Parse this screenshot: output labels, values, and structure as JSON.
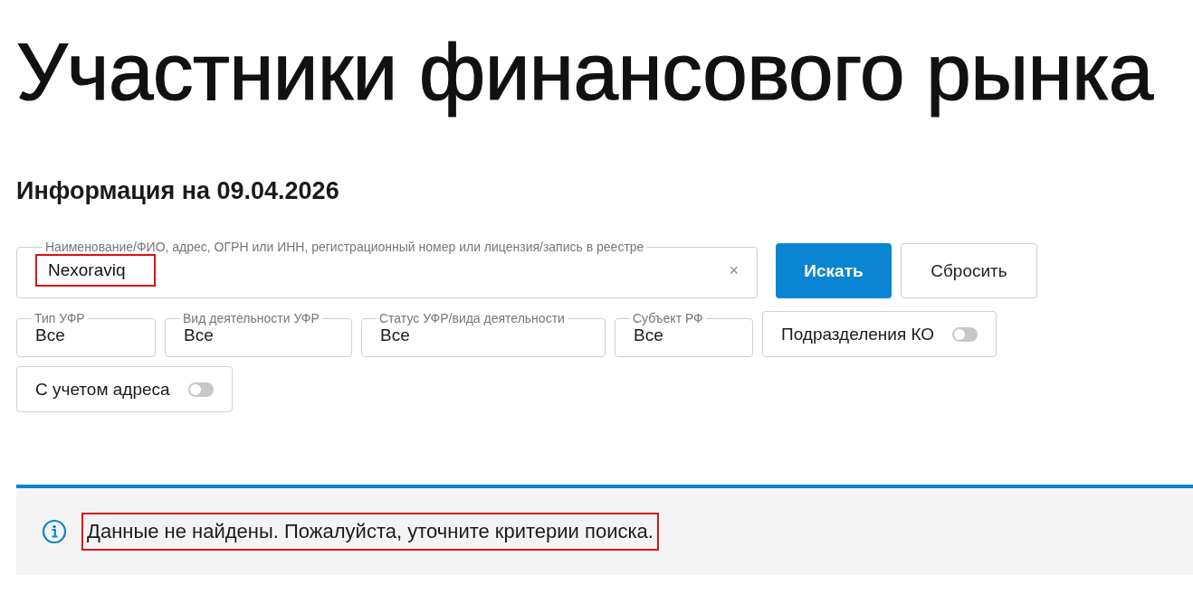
{
  "title": "Участники финансового рынка",
  "subtitle": "Информация на 09.04.2026",
  "search": {
    "label": "Наименование/ФИО, адрес, ОГРН или ИНН, регистрационный номер или лицензия/запись в реестре",
    "value": "Nexoraviq",
    "highlighted": true,
    "clear": "×"
  },
  "buttons": [
    {
      "label": "Искать",
      "kind": "primary"
    },
    {
      "label": "Сбросить",
      "kind": "secondary"
    }
  ],
  "filters": [
    {
      "kind": "dropdown",
      "label": "Тип УФР",
      "value": "Все"
    },
    {
      "kind": "dropdown",
      "label": "Вид деятельности УФР",
      "value": "Все"
    },
    {
      "kind": "dropdown",
      "label": "Статус УФР/вида деятельности",
      "value": "Все"
    },
    {
      "kind": "dropdown",
      "label": "Субъект РФ",
      "value": "Все"
    },
    {
      "kind": "toggle",
      "label": "Подразделения КО",
      "on": false
    },
    {
      "kind": "toggle",
      "label": "С учетом адреса",
      "on": false
    }
  ],
  "message": {
    "text": "Данные не найдены. Пожалуйста, уточните критерии поиска.",
    "highlighted": true
  }
}
